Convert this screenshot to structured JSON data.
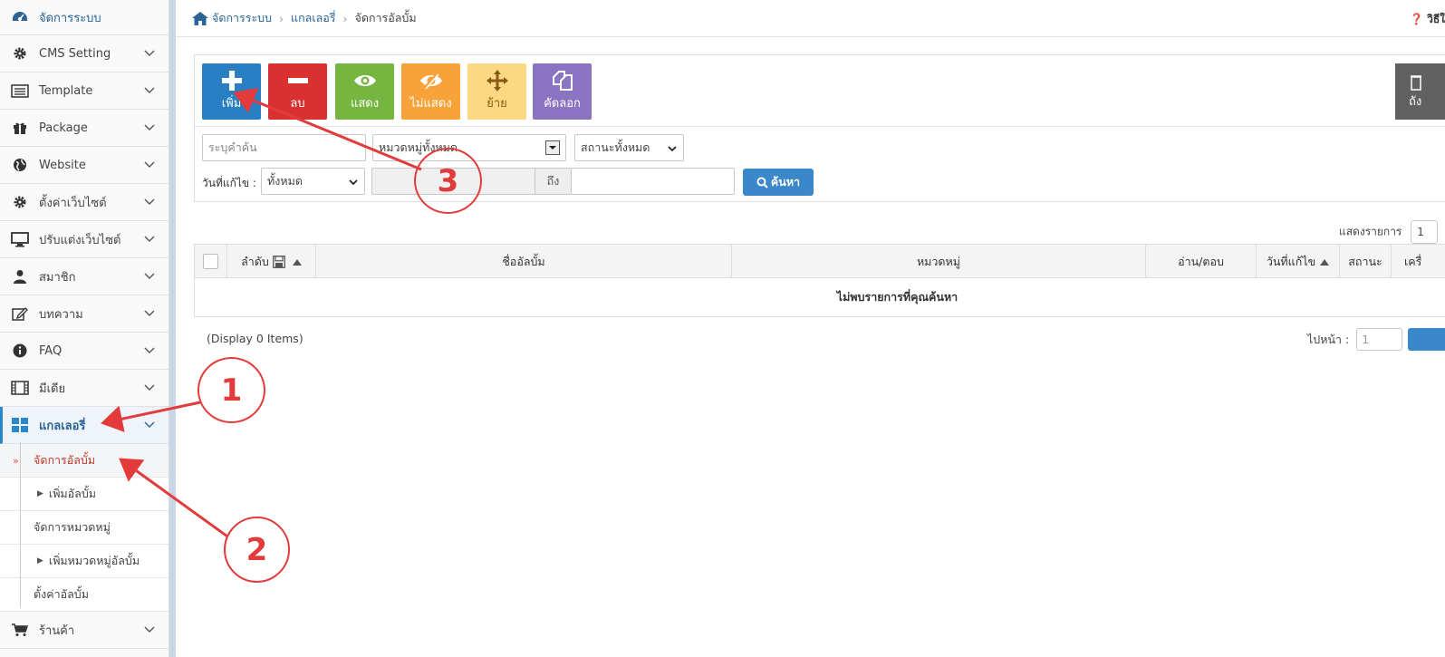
{
  "breadcrumb": {
    "items": [
      "จัดการระบบ",
      "แกลเลอรี่",
      "จัดการอัลบั้ม"
    ]
  },
  "help": {
    "label": "วิธีใ"
  },
  "sidebar": {
    "items": [
      {
        "label": "จัดการระบบ",
        "icon": "dashboard-icon"
      },
      {
        "label": "CMS Setting",
        "icon": "gear-icon"
      },
      {
        "label": "Template",
        "icon": "template-icon"
      },
      {
        "label": "Package",
        "icon": "gift-icon"
      },
      {
        "label": "Website",
        "icon": "globe-icon"
      },
      {
        "label": "ตั้งค่าเว็บไซต์",
        "icon": "gear-icon"
      },
      {
        "label": "ปรับแต่งเว็บไซต์",
        "icon": "monitor-icon"
      },
      {
        "label": "สมาชิก",
        "icon": "user-icon"
      },
      {
        "label": "บทความ",
        "icon": "edit-icon"
      },
      {
        "label": "FAQ",
        "icon": "info-icon"
      },
      {
        "label": "มีเดีย",
        "icon": "film-icon"
      },
      {
        "label": "แกลเลอรี่",
        "icon": "grid-icon"
      }
    ],
    "subitems": [
      "จัดการอัลบั้ม",
      "เพิ่มอัลบั้ม",
      "จัดการหมวดหมู่",
      "เพิ่มหมวดหมู่อัลบั้ม",
      "ตั้งค่าอัลบั้ม"
    ],
    "last_item": {
      "label": "ร้านค้า",
      "icon": "cart-icon"
    }
  },
  "toolbar": {
    "add": "เพิ่ม",
    "delete": "ลบ",
    "show": "แสดง",
    "hide": "ไม่แสดง",
    "move": "ย้าย",
    "copy": "คัดลอก",
    "trash": "ถัง"
  },
  "filters": {
    "keyword_placeholder": "ระบุคำค้น",
    "category": "หมวดหมู่ทั้งหมด",
    "status": "สถานะทั้งหมด",
    "date_label": "วันที่แก้ไข :",
    "date_option": "ทั้งหมด",
    "to_label": "ถึง",
    "search": "ค้นหา"
  },
  "listing": {
    "label": "แสดงรายการ",
    "value": "1"
  },
  "table": {
    "columns": [
      "ลำดับ",
      "ชื่ออัลบั้ม",
      "หมวดหมู่",
      "อ่าน/ตอบ",
      "วันที่แก้ไข",
      "สถานะ",
      "เครื่"
    ],
    "empty": "ไม่พบรายการที่คุณค้นหา"
  },
  "footer": {
    "display_items": "(Display 0 Items)",
    "goto_label": "ไปหน้า :",
    "goto_value": "1"
  },
  "annotations": [
    "1",
    "2",
    "3"
  ],
  "colors": {
    "primary": "#2a7fc3",
    "danger": "#d9312f",
    "success": "#74b640",
    "warning": "#f7a33a",
    "move": "#fcd882",
    "copy": "#8b74c2",
    "annotation": "#e33b3b"
  }
}
